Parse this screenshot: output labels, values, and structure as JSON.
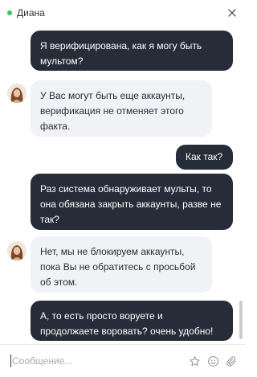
{
  "header": {
    "contact_name": "Диана",
    "status": "online",
    "status_color": "#3cc45a"
  },
  "messages": [
    {
      "direction": "outgoing",
      "lines": [
        "Я верифицирована, как я могу быть",
        "мультом?"
      ]
    },
    {
      "direction": "incoming",
      "lines": [
        "У Вас могут быть еще аккаунты,",
        "верификация не отменяет этого",
        "факта."
      ]
    },
    {
      "direction": "outgoing",
      "lines": [
        "Как так?"
      ]
    },
    {
      "direction": "outgoing",
      "lines": [
        "Раз система обнаруживает мульты, то",
        "она обязана закрыть аккаунты, разве не",
        "так?"
      ]
    },
    {
      "direction": "incoming",
      "lines": [
        "Нет, мы не блокируем аккаунты,",
        "пока Вы не обратитесь с просьбой",
        "об этом."
      ]
    },
    {
      "direction": "outgoing",
      "lines": [
        "А, то есть просто воруете и",
        "продолжаете воровать? очень удобно!"
      ]
    }
  ],
  "composer": {
    "placeholder": "Сообщение..."
  },
  "icons": {
    "close": "close-icon",
    "star": "star-icon",
    "emoji": "emoji-icon",
    "attach": "paperclip-icon"
  },
  "colors": {
    "outgoing_bubble": "#262c38",
    "incoming_bubble": "#f1f2f5"
  }
}
